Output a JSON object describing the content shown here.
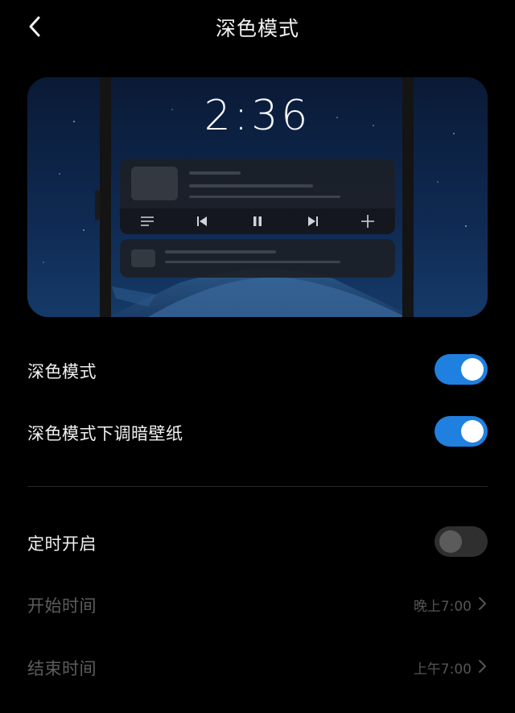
{
  "header": {
    "title": "深色模式",
    "back_icon": "chevron-left-icon"
  },
  "preview": {
    "clock_time": "2:36",
    "media_controls": [
      "playlist-icon",
      "previous-icon",
      "pause-icon",
      "next-icon",
      "plus-icon"
    ]
  },
  "settings": {
    "dark_mode": {
      "label": "深色模式",
      "enabled": true
    },
    "dim_wallpaper": {
      "label": "深色模式下调暗壁纸",
      "enabled": true
    },
    "scheduled": {
      "label": "定时开启",
      "enabled": false
    },
    "start_time": {
      "label": "开始时间",
      "value": "晚上7:00"
    },
    "end_time": {
      "label": "结束时间",
      "value": "上午7:00"
    }
  },
  "colors": {
    "accent": "#1f80e0",
    "background": "#000000",
    "disabled_text": "#5d5d5d"
  }
}
